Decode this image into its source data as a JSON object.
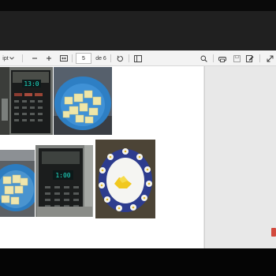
{
  "toolbar": {
    "zoom_label": "ipt",
    "page_number": "5",
    "page_total": "de 6"
  },
  "icons": [
    "chevron-down-icon",
    "minus-icon",
    "plus-icon",
    "fit-page-icon",
    "rotate-icon",
    "two-page-icon",
    "search-icon",
    "print-icon",
    "save-icon",
    "edit-icon",
    "fullscreen-icon"
  ],
  "colors": {
    "toolbar_bg": "#f3f3f3",
    "page_bg": "#ffffff",
    "side_pane_bg": "#e8e8e8",
    "microwave_display": "#1fe0c8"
  },
  "photos": {
    "microwave_display_text": "13:0",
    "microwave_display_text_2": "1:00"
  }
}
